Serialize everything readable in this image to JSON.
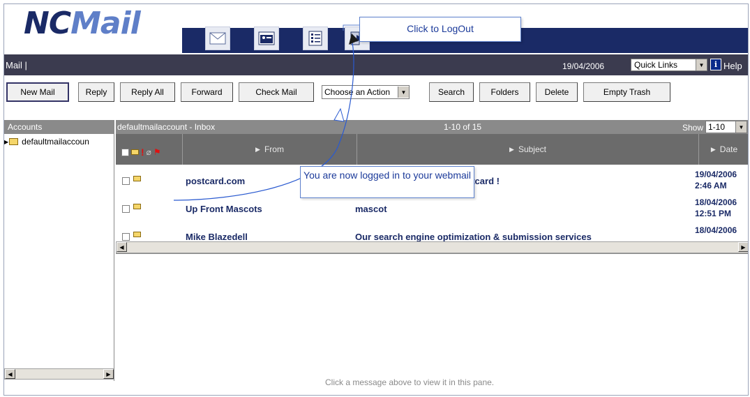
{
  "logo": {
    "text_nc": "NC",
    "text_mail": "Mail"
  },
  "nav_icons": [
    "mail-icon",
    "contacts-icon",
    "list-icon",
    "logout-icon"
  ],
  "callouts": {
    "logout": "Click to LogOut",
    "logged_in": "You are now logged in to your webmail"
  },
  "topbar": {
    "app_label": "Mail  |",
    "date": "19/04/2006",
    "quick_links": "Quick Links",
    "help": "Help"
  },
  "toolbar": {
    "new_mail": "New Mail",
    "reply": "Reply",
    "reply_all": "Reply All",
    "forward": "Forward",
    "check_mail": "Check Mail",
    "action_select": "Choose an Action",
    "search": "Search",
    "folders": "Folders",
    "delete": "Delete",
    "empty_trash": "Empty Trash"
  },
  "accounts": {
    "header": "Accounts",
    "items": [
      {
        "label": "defaultmailaccoun"
      }
    ]
  },
  "inbox": {
    "title": "defaultmailaccount - Inbox",
    "range": "1-10 of 15",
    "show_label": "Show",
    "show_value": "1-10",
    "columns": {
      "from": "From",
      "subject": "Subject",
      "date": "Date"
    },
    "rows": [
      {
        "from": "postcard.com",
        "subject": "stcard !",
        "date": "19/04/2006",
        "time": "2:46 AM"
      },
      {
        "from": "Up Front Mascots",
        "subject": "mascot",
        "date": "18/04/2006",
        "time": "12:51 PM"
      },
      {
        "from": "Mike Blazedell",
        "subject": "Our search engine optimization & submission services",
        "date": "18/04/2006",
        "time": ""
      }
    ]
  },
  "preview": {
    "message": "Click a message above to view it in this pane."
  },
  "colors": {
    "navy": "#1a2a66",
    "dark_bar": "#3b3b4f",
    "header_gray": "#8a8a8a",
    "callout_border": "#5b7fcc"
  }
}
